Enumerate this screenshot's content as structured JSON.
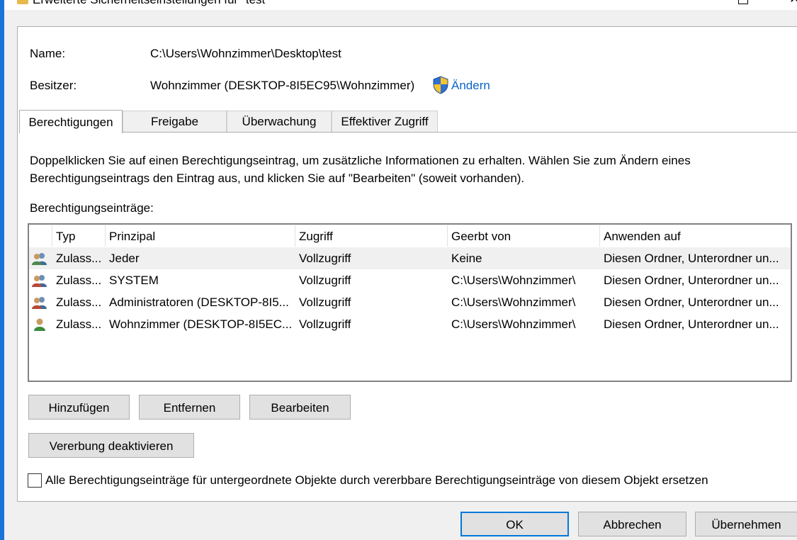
{
  "window": {
    "title": "Erweiterte Sicherheitseinstellungen für \"test\""
  },
  "info": {
    "name_label": "Name:",
    "name_value": "C:\\Users\\Wohnzimmer\\Desktop\\test",
    "owner_label": "Besitzer:",
    "owner_value": "Wohnzimmer (DESKTOP-8I5EC95\\Wohnzimmer)",
    "change_link": "Ändern"
  },
  "tabs": [
    {
      "label": "Berechtigungen",
      "active": true
    },
    {
      "label": "Freigabe",
      "active": false
    },
    {
      "label": "Überwachung",
      "active": false
    },
    {
      "label": "Effektiver Zugriff",
      "active": false
    }
  ],
  "description": "Doppelklicken Sie auf einen Berechtigungseintrag, um zusätzliche Informationen zu erhalten. Wählen Sie zum Ändern eines Berechtigungseintrags den Eintrag aus, und klicken Sie auf \"Bearbeiten\" (soweit vorhanden).",
  "list": {
    "label": "Berechtigungseinträge:",
    "columns": [
      "Typ",
      "Prinzipal",
      "Zugriff",
      "Geerbt von",
      "Anwenden auf"
    ],
    "rows": [
      {
        "icon": "user-group-icon",
        "type": "Zulass...",
        "principal": "Jeder",
        "access": "Vollzugriff",
        "inherited": "Keine",
        "applies": "Diesen Ordner, Unterordner un..."
      },
      {
        "icon": "user-group-icon",
        "type": "Zulass...",
        "principal": "SYSTEM",
        "access": "Vollzugriff",
        "inherited": "C:\\Users\\Wohnzimmer\\",
        "applies": "Diesen Ordner, Unterordner un..."
      },
      {
        "icon": "user-group-icon",
        "type": "Zulass...",
        "principal": "Administratoren (DESKTOP-8I5...",
        "access": "Vollzugriff",
        "inherited": "C:\\Users\\Wohnzimmer\\",
        "applies": "Diesen Ordner, Unterordner un..."
      },
      {
        "icon": "user-icon",
        "type": "Zulass...",
        "principal": "Wohnzimmer (DESKTOP-8I5EC...",
        "access": "Vollzugriff",
        "inherited": "C:\\Users\\Wohnzimmer\\",
        "applies": "Diesen Ordner, Unterordner un..."
      }
    ]
  },
  "buttons": {
    "add": "Hinzufügen",
    "remove": "Entfernen",
    "edit": "Bearbeiten",
    "disable_inheritance": "Vererbung deaktivieren",
    "ok": "OK",
    "cancel": "Abbrechen",
    "apply": "Übernehmen"
  },
  "replace_checkbox": {
    "label": "Alle Berechtigungseinträge für untergeordnete Objekte durch vererbbare Berechtigungseinträge von diesem Objekt ersetzen",
    "checked": false
  },
  "colors": {
    "link": "#0b64c8",
    "accent": "#0078d7",
    "window_edge": "#1a73d9"
  }
}
